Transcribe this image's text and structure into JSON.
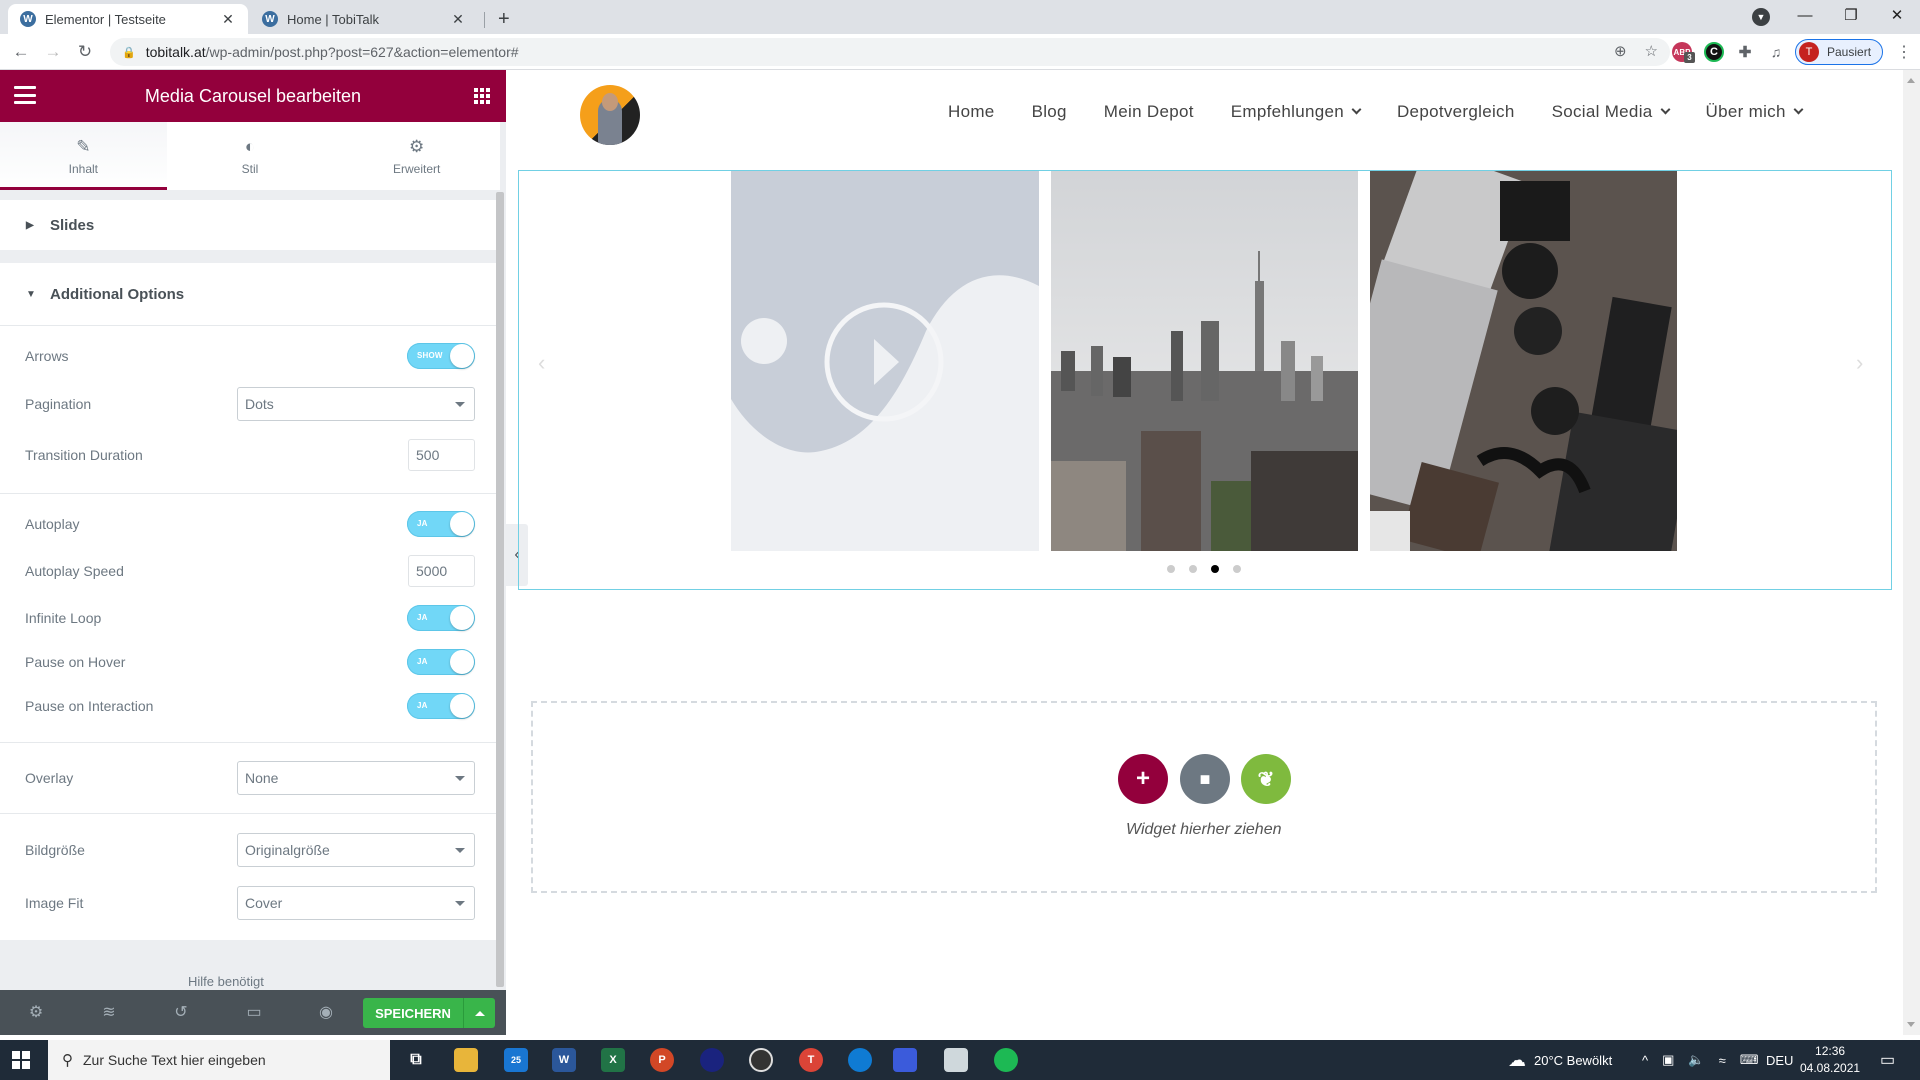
{
  "browser": {
    "tabs": [
      {
        "title": "Elementor | Testseite",
        "active": true
      },
      {
        "title": "Home | TobiTalk",
        "active": false
      }
    ],
    "url_host": "tobitalk.at",
    "url_path": "/wp-admin/post.php?post=627&action=elementor#",
    "extension_badge": "3",
    "profile_initial": "T",
    "profile_status": "Pausiert"
  },
  "panel": {
    "title": "Media Carousel bearbeiten",
    "tabs": [
      {
        "label": "Inhalt",
        "icon": "pencil-icon",
        "active": true
      },
      {
        "label": "Stil",
        "icon": "half-circle-icon",
        "active": false
      },
      {
        "label": "Erweitert",
        "icon": "gear-icon",
        "active": false
      }
    ],
    "sections": {
      "slides": {
        "label": "Slides",
        "expanded": false
      },
      "additional": {
        "label": "Additional Options",
        "expanded": true
      }
    },
    "options": {
      "arrows": {
        "label": "Arrows",
        "toggle_text": "SHOW",
        "on": true
      },
      "pagination": {
        "label": "Pagination",
        "value": "Dots"
      },
      "transition_duration": {
        "label": "Transition Duration",
        "value": "500"
      },
      "autoplay": {
        "label": "Autoplay",
        "toggle_text": "JA",
        "on": true
      },
      "autoplay_speed": {
        "label": "Autoplay Speed",
        "value": "5000"
      },
      "infinite_loop": {
        "label": "Infinite Loop",
        "toggle_text": "JA",
        "on": true
      },
      "pause_on_hover": {
        "label": "Pause on Hover",
        "toggle_text": "JA",
        "on": true
      },
      "pause_on_interaction": {
        "label": "Pause on Interaction",
        "toggle_text": "JA",
        "on": true
      },
      "overlay": {
        "label": "Overlay",
        "value": "None"
      },
      "image_size": {
        "label": "Bildgröße",
        "value": "Originalgröße"
      },
      "image_fit": {
        "label": "Image Fit",
        "value": "Cover"
      }
    },
    "help_text": "Hilfe benötigt",
    "footer": {
      "save_label": "SPEICHERN"
    }
  },
  "site": {
    "nav": [
      {
        "label": "Home",
        "dropdown": false
      },
      {
        "label": "Blog",
        "dropdown": false
      },
      {
        "label": "Mein Depot",
        "dropdown": false
      },
      {
        "label": "Empfehlungen",
        "dropdown": true
      },
      {
        "label": "Depotvergleich",
        "dropdown": false
      },
      {
        "label": "Social Media",
        "dropdown": true
      },
      {
        "label": "Über mich",
        "dropdown": true
      }
    ],
    "carousel": {
      "slides": [
        "video-placeholder",
        "city-skyline",
        "camera-desk"
      ],
      "dots_total": 4,
      "active_dot": 3
    },
    "dropzone_text": "Widget hierher ziehen"
  },
  "taskbar": {
    "search_placeholder": "Zur Suche Text hier eingeben",
    "mail_badge": "25",
    "weather": "20°C  Bewölkt",
    "language": "DEU",
    "time": "12:36",
    "date": "04.08.2021"
  },
  "colors": {
    "elementor_brand": "#93003c",
    "toggle_on": "#71d7f7",
    "save_green": "#39b54a",
    "carousel_border": "#71d0e4"
  }
}
